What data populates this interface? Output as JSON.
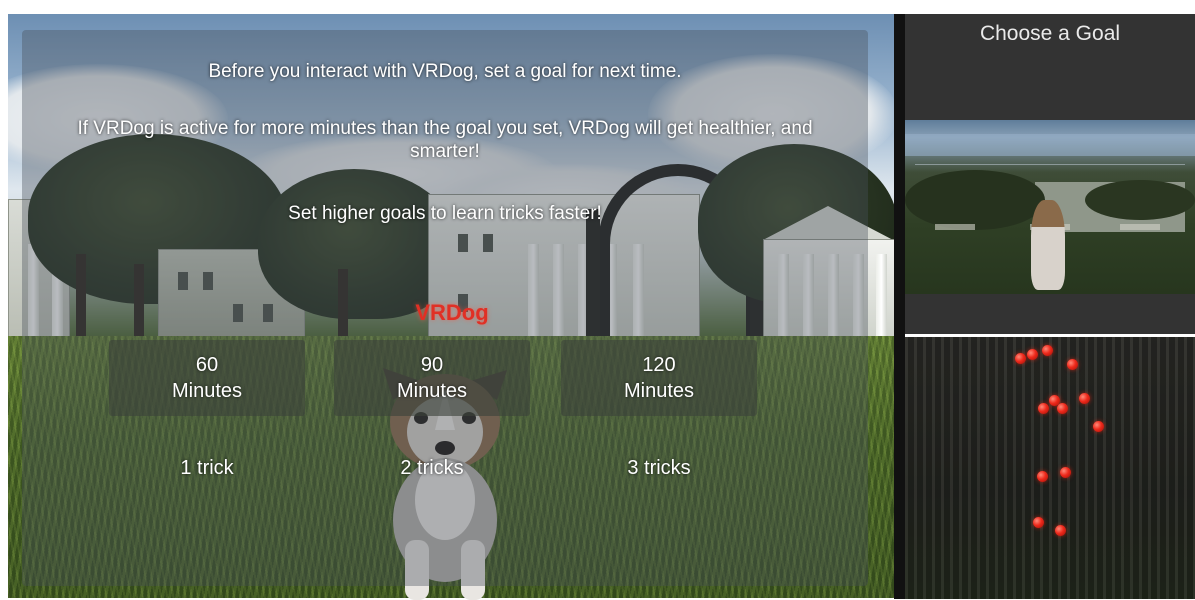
{
  "preview": {
    "title": "Choose a Goal"
  },
  "goal_panel": {
    "instruction_1": "Before you interact with VRDog, set a goal for next time.",
    "instruction_2": "If VRDog is active for more minutes than the goal you set, VRDog will get healthier, and smarter!",
    "instruction_3": "Set higher goals to learn tricks faster!",
    "dog_label": "VRDog",
    "options": [
      {
        "minutes": "60",
        "unit": "Minutes",
        "reward": "1 trick"
      },
      {
        "minutes": "90",
        "unit": "Minutes",
        "reward": "2 tricks"
      },
      {
        "minutes": "120",
        "unit": "Minutes",
        "reward": "3 tricks"
      }
    ]
  },
  "colors": {
    "dog_label": "#e03025",
    "berry": "#ef2a1c",
    "panel_bg": "#333333"
  }
}
